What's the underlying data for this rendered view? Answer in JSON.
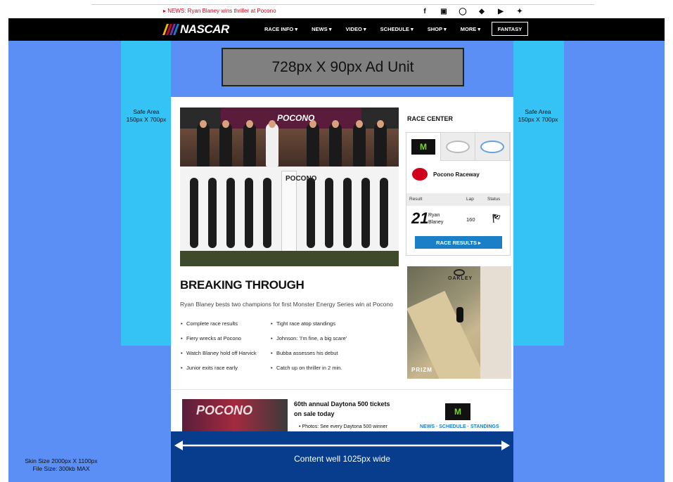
{
  "topbar": {
    "news": "▸ NEWS: Ryan Blaney wins thriller at Pocono",
    "social_icons": [
      "facebook-icon",
      "instagram-icon",
      "snapchat-icon",
      "twitter-icon",
      "youtube-icon",
      "tumblr-icon"
    ]
  },
  "nav": {
    "logo": "NASCAR",
    "items": [
      "RACE INFO ▾",
      "NEWS ▾",
      "VIDEO ▾",
      "SCHEDULE ▾",
      "SHOP ▾",
      "MORE ▾"
    ],
    "fantasy": "FANTASY"
  },
  "skin": {
    "ad_unit": "728px X 90px Ad Unit",
    "safe_area_left": "Safe Area\n150px X 700px",
    "safe_area_right": "Safe Area\n150px X 700px",
    "content_well": "Content well 1025px wide",
    "skin_size": "Skin Size 2000px X 1100px",
    "file_size": "File Size: 300kb MAX",
    "colors": {
      "skin": "#5b8ff5",
      "safe": "#35c3f5",
      "well": "#073d8c"
    }
  },
  "hero": {
    "banner_text": "POCONO",
    "post_text": "POCONO",
    "headline": "BREAKING THROUGH",
    "subhead": "Ryan Blaney bests two champions for first Monster Energy Series win at Pocono",
    "bullets_left": [
      "Complete race results",
      "Fiery wrecks at Pocono",
      "Watch Blaney hold off Harvick",
      "Junior exits race early"
    ],
    "bullets_right": [
      "Tight race atop standings",
      "Johnson: 'I'm fine, a big scare'",
      "Bubba assesses his debut",
      "Catch up on thriller in 2 min."
    ]
  },
  "race_center": {
    "title": "RACE CENTER",
    "track": "Pocono Raceway",
    "col_result": "Result",
    "col_lap": "Lap",
    "col_status": "Status",
    "number": "21",
    "driver": "Ryan Blaney",
    "lap": "160",
    "button": "RACE RESULTS ▸"
  },
  "ad": {
    "brand": "OAKLEY",
    "product": "PRIZM"
  },
  "lower": {
    "image_text": "POCONO",
    "title": "60th annual Daytona 500 tickets on sale today",
    "bullet": "•  Photos: See every Daytona 500 winner",
    "links": "NEWS  ·  SCHEDULE  ·  STANDINGS"
  }
}
